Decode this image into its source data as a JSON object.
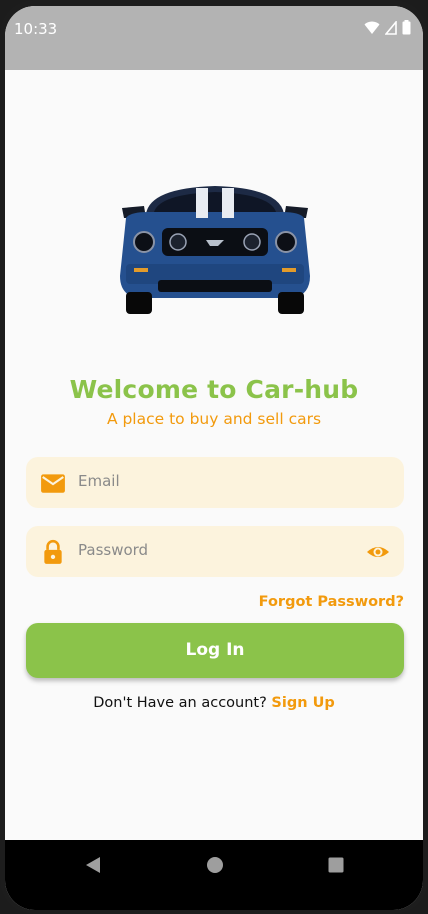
{
  "status_bar": {
    "time": "10:33",
    "icons": [
      "wifi-icon",
      "cell-signal-icon",
      "battery-icon"
    ]
  },
  "hero": {
    "image": "blue-muscle-car-front"
  },
  "welcome": {
    "title": "Welcome to Car-hub",
    "subtitle": "A place to buy and sell cars"
  },
  "form": {
    "email": {
      "icon": "mail-icon",
      "placeholder": "Email",
      "value": ""
    },
    "password": {
      "icon": "lock-icon",
      "placeholder": "Password",
      "value": "",
      "toggle_icon": "eye-icon"
    },
    "forgot_label": "Forgot Password?",
    "login_label": "Log In"
  },
  "signup": {
    "prompt": "Don't Have an account?",
    "link": "Sign Up"
  },
  "nav": {
    "buttons": [
      "back-icon",
      "home-icon",
      "recents-icon"
    ]
  },
  "colors": {
    "accent_green": "#8bc34a",
    "accent_orange": "#f29a0d",
    "field_bg": "#fcf3dd",
    "status_bar": "#b3b3b3"
  }
}
